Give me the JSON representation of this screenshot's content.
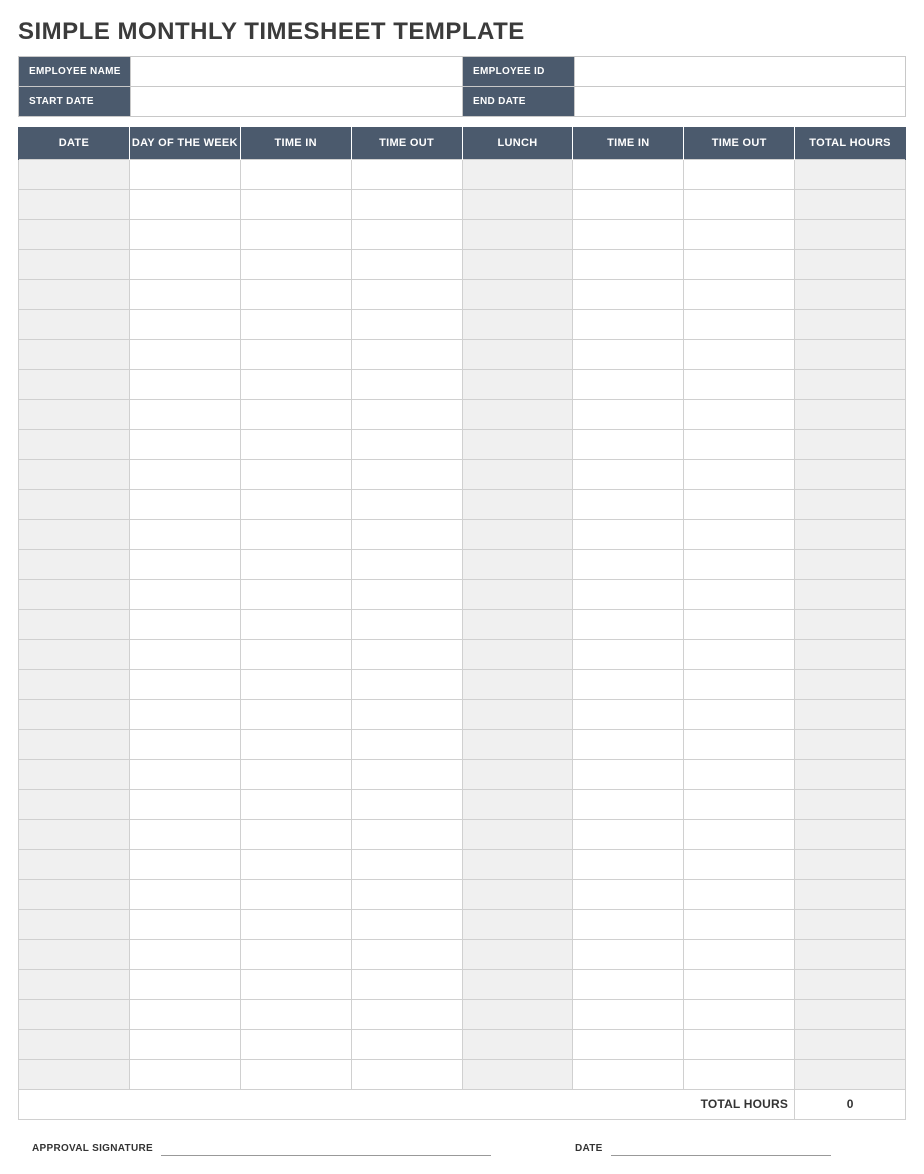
{
  "title": "SIMPLE MONTHLY TIMESHEET TEMPLATE",
  "info": {
    "employee_name_label": "EMPLOYEE NAME",
    "employee_name_value": "",
    "employee_id_label": "EMPLOYEE ID",
    "employee_id_value": "",
    "start_date_label": "START DATE",
    "start_date_value": "",
    "end_date_label": "END DATE",
    "end_date_value": ""
  },
  "columns": {
    "date": "DATE",
    "day_of_week": "DAY OF THE WEEK",
    "time_in_1": "TIME IN",
    "time_out_1": "TIME OUT",
    "lunch": "LUNCH",
    "time_in_2": "TIME IN",
    "time_out_2": "TIME OUT",
    "total_hours": "TOTAL HOURS"
  },
  "rows": [
    {
      "date": "",
      "day_of_week": "",
      "time_in_1": "",
      "time_out_1": "",
      "lunch": "",
      "time_in_2": "",
      "time_out_2": "",
      "total_hours": ""
    },
    {
      "date": "",
      "day_of_week": "",
      "time_in_1": "",
      "time_out_1": "",
      "lunch": "",
      "time_in_2": "",
      "time_out_2": "",
      "total_hours": ""
    },
    {
      "date": "",
      "day_of_week": "",
      "time_in_1": "",
      "time_out_1": "",
      "lunch": "",
      "time_in_2": "",
      "time_out_2": "",
      "total_hours": ""
    },
    {
      "date": "",
      "day_of_week": "",
      "time_in_1": "",
      "time_out_1": "",
      "lunch": "",
      "time_in_2": "",
      "time_out_2": "",
      "total_hours": ""
    },
    {
      "date": "",
      "day_of_week": "",
      "time_in_1": "",
      "time_out_1": "",
      "lunch": "",
      "time_in_2": "",
      "time_out_2": "",
      "total_hours": ""
    },
    {
      "date": "",
      "day_of_week": "",
      "time_in_1": "",
      "time_out_1": "",
      "lunch": "",
      "time_in_2": "",
      "time_out_2": "",
      "total_hours": ""
    },
    {
      "date": "",
      "day_of_week": "",
      "time_in_1": "",
      "time_out_1": "",
      "lunch": "",
      "time_in_2": "",
      "time_out_2": "",
      "total_hours": ""
    },
    {
      "date": "",
      "day_of_week": "",
      "time_in_1": "",
      "time_out_1": "",
      "lunch": "",
      "time_in_2": "",
      "time_out_2": "",
      "total_hours": ""
    },
    {
      "date": "",
      "day_of_week": "",
      "time_in_1": "",
      "time_out_1": "",
      "lunch": "",
      "time_in_2": "",
      "time_out_2": "",
      "total_hours": ""
    },
    {
      "date": "",
      "day_of_week": "",
      "time_in_1": "",
      "time_out_1": "",
      "lunch": "",
      "time_in_2": "",
      "time_out_2": "",
      "total_hours": ""
    },
    {
      "date": "",
      "day_of_week": "",
      "time_in_1": "",
      "time_out_1": "",
      "lunch": "",
      "time_in_2": "",
      "time_out_2": "",
      "total_hours": ""
    },
    {
      "date": "",
      "day_of_week": "",
      "time_in_1": "",
      "time_out_1": "",
      "lunch": "",
      "time_in_2": "",
      "time_out_2": "",
      "total_hours": ""
    },
    {
      "date": "",
      "day_of_week": "",
      "time_in_1": "",
      "time_out_1": "",
      "lunch": "",
      "time_in_2": "",
      "time_out_2": "",
      "total_hours": ""
    },
    {
      "date": "",
      "day_of_week": "",
      "time_in_1": "",
      "time_out_1": "",
      "lunch": "",
      "time_in_2": "",
      "time_out_2": "",
      "total_hours": ""
    },
    {
      "date": "",
      "day_of_week": "",
      "time_in_1": "",
      "time_out_1": "",
      "lunch": "",
      "time_in_2": "",
      "time_out_2": "",
      "total_hours": ""
    },
    {
      "date": "",
      "day_of_week": "",
      "time_in_1": "",
      "time_out_1": "",
      "lunch": "",
      "time_in_2": "",
      "time_out_2": "",
      "total_hours": ""
    },
    {
      "date": "",
      "day_of_week": "",
      "time_in_1": "",
      "time_out_1": "",
      "lunch": "",
      "time_in_2": "",
      "time_out_2": "",
      "total_hours": ""
    },
    {
      "date": "",
      "day_of_week": "",
      "time_in_1": "",
      "time_out_1": "",
      "lunch": "",
      "time_in_2": "",
      "time_out_2": "",
      "total_hours": ""
    },
    {
      "date": "",
      "day_of_week": "",
      "time_in_1": "",
      "time_out_1": "",
      "lunch": "",
      "time_in_2": "",
      "time_out_2": "",
      "total_hours": ""
    },
    {
      "date": "",
      "day_of_week": "",
      "time_in_1": "",
      "time_out_1": "",
      "lunch": "",
      "time_in_2": "",
      "time_out_2": "",
      "total_hours": ""
    },
    {
      "date": "",
      "day_of_week": "",
      "time_in_1": "",
      "time_out_1": "",
      "lunch": "",
      "time_in_2": "",
      "time_out_2": "",
      "total_hours": ""
    },
    {
      "date": "",
      "day_of_week": "",
      "time_in_1": "",
      "time_out_1": "",
      "lunch": "",
      "time_in_2": "",
      "time_out_2": "",
      "total_hours": ""
    },
    {
      "date": "",
      "day_of_week": "",
      "time_in_1": "",
      "time_out_1": "",
      "lunch": "",
      "time_in_2": "",
      "time_out_2": "",
      "total_hours": ""
    },
    {
      "date": "",
      "day_of_week": "",
      "time_in_1": "",
      "time_out_1": "",
      "lunch": "",
      "time_in_2": "",
      "time_out_2": "",
      "total_hours": ""
    },
    {
      "date": "",
      "day_of_week": "",
      "time_in_1": "",
      "time_out_1": "",
      "lunch": "",
      "time_in_2": "",
      "time_out_2": "",
      "total_hours": ""
    },
    {
      "date": "",
      "day_of_week": "",
      "time_in_1": "",
      "time_out_1": "",
      "lunch": "",
      "time_in_2": "",
      "time_out_2": "",
      "total_hours": ""
    },
    {
      "date": "",
      "day_of_week": "",
      "time_in_1": "",
      "time_out_1": "",
      "lunch": "",
      "time_in_2": "",
      "time_out_2": "",
      "total_hours": ""
    },
    {
      "date": "",
      "day_of_week": "",
      "time_in_1": "",
      "time_out_1": "",
      "lunch": "",
      "time_in_2": "",
      "time_out_2": "",
      "total_hours": ""
    },
    {
      "date": "",
      "day_of_week": "",
      "time_in_1": "",
      "time_out_1": "",
      "lunch": "",
      "time_in_2": "",
      "time_out_2": "",
      "total_hours": ""
    },
    {
      "date": "",
      "day_of_week": "",
      "time_in_1": "",
      "time_out_1": "",
      "lunch": "",
      "time_in_2": "",
      "time_out_2": "",
      "total_hours": ""
    },
    {
      "date": "",
      "day_of_week": "",
      "time_in_1": "",
      "time_out_1": "",
      "lunch": "",
      "time_in_2": "",
      "time_out_2": "",
      "total_hours": ""
    }
  ],
  "footer": {
    "total_hours_label": "TOTAL HOURS",
    "total_hours_value": "0",
    "approval_signature_label": "APPROVAL SIGNATURE",
    "date_label": "DATE"
  }
}
